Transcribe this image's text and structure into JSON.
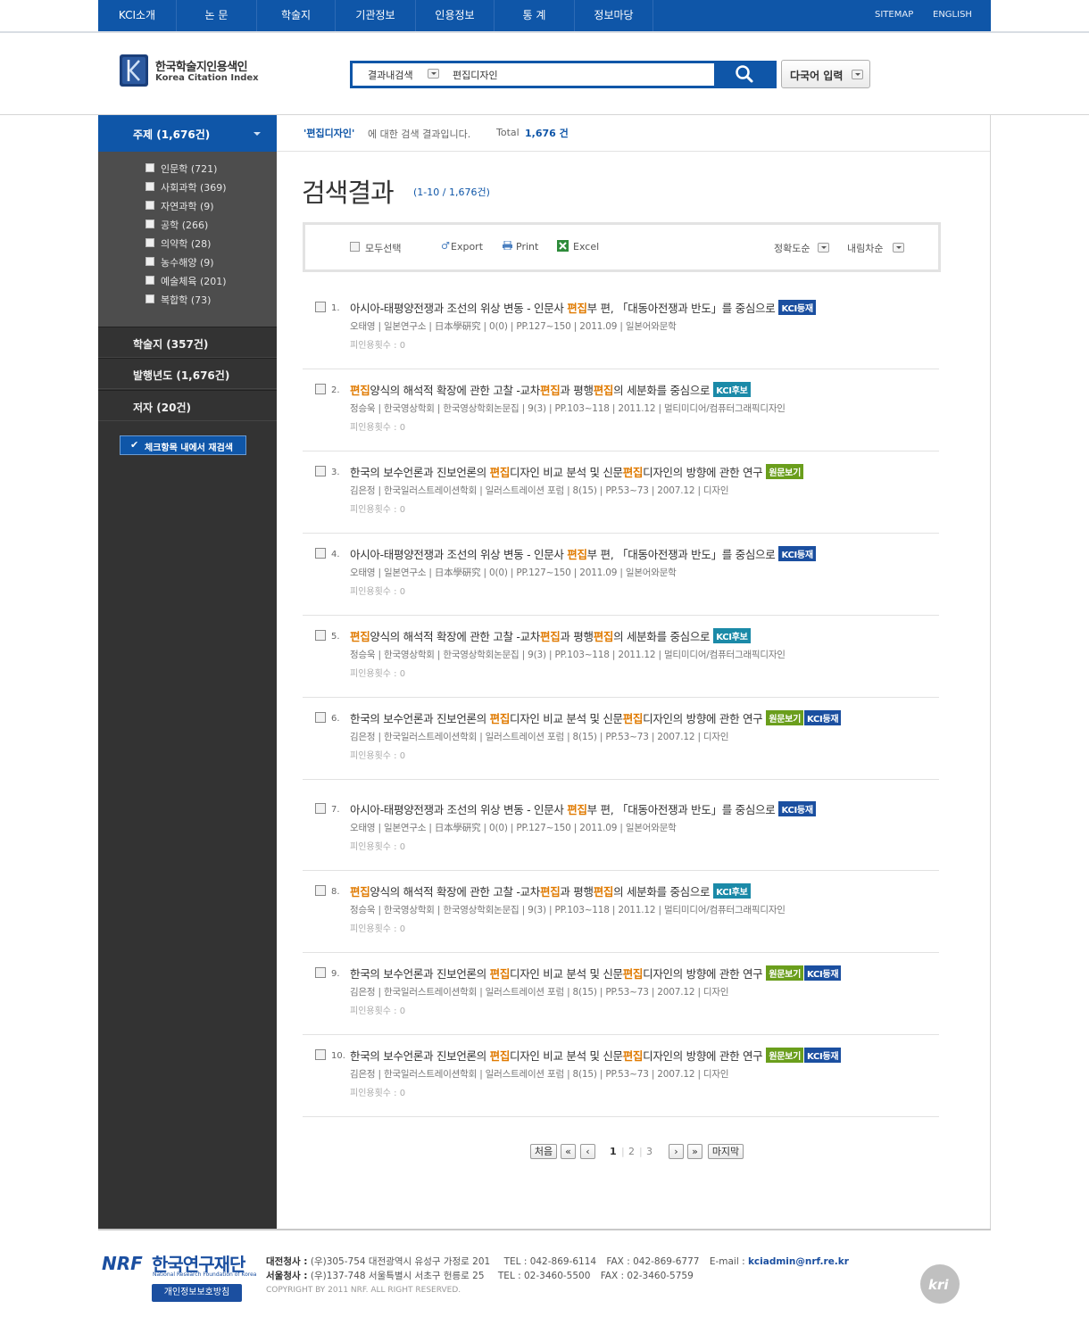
{
  "nav": {
    "items": [
      "KCI소개",
      "논 문",
      "학술지",
      "기관정보",
      "인용정보",
      "통 계",
      "정보마당"
    ],
    "sitemap": "SITEMAP",
    "english": "ENGLISH"
  },
  "logo": {
    "ko": "한국학술지인용색인",
    "en": "Korea Citation Index"
  },
  "search": {
    "scope": "결과내검색",
    "query": "편집디자인",
    "multilang": "다국어 입력"
  },
  "sidebar": {
    "subject_head": "주제 (1,676건)",
    "subjects": [
      "인문학 (721)",
      "사회과학 (369)",
      "자연과학 (9)",
      "공학 (266)",
      "의약학 (28)",
      "농수해양 (9)",
      "예술체육 (201)",
      "복합학 (73)"
    ],
    "journal": "학술지 (357건)",
    "year": "발행년도 (1,676건)",
    "author": "저자 (20건)",
    "research_btn": "체크항목 내에서 재검색",
    "research_check": "✔"
  },
  "summary": {
    "keyword": "'편집디자인'",
    "text1": "에 대한 검색 결과입니다.",
    "text2": "Total",
    "total": "1,676 건"
  },
  "results_head": {
    "title": "검색결과",
    "range": "(1-10 / 1,676건)"
  },
  "toolbar": {
    "select_all": "모두선택",
    "export": "Export",
    "print": "Print",
    "excel": "Excel",
    "sort1": "정확도순",
    "sort2": "내림차순"
  },
  "results": [
    {
      "num": "1.",
      "pre": "아시아-태평양전쟁과 조선의 위상 변동 - 인문사 ",
      "h1": "편집",
      "mid": "부 편, 「대동아전쟁과 반도」를 중심으로",
      "h2": "",
      "post": "",
      "badges": [
        {
          "label": "KCI등재",
          "type": "reg"
        }
      ],
      "meta": "오태영 | 일본연구소 | 日本學硏究 | 0(0) | PP.127~150 | 2011.09 | 일본어와문학",
      "cite": "피인용횟수 : 0"
    },
    {
      "num": "2.",
      "pre": "",
      "h1": "편집",
      "mid": "양식의 해석적 확장에 관한 고찰 -교차",
      "h2": "편집",
      "post": "과 평행",
      "h3": "편집",
      "tail": "의 세분화를 중심으로",
      "badges": [
        {
          "label": "KCI후보",
          "type": "cand"
        }
      ],
      "meta": "정승욱 | 한국영상학회 | 한국영상학회논문집 | 9(3) | PP.103~118 | 2011.12 | 멀티미디어/컴퓨터그래픽디자인",
      "cite": "피인용횟수 : 0"
    },
    {
      "num": "3.",
      "pre": "한국의 보수언론과 진보언론의 ",
      "h1": "편집",
      "mid": "디자인 비교 분석 및 신문",
      "h2": "편집",
      "post": "디자인의 방향에 관한 연구",
      "badges": [
        {
          "label": "원문보기",
          "type": "full"
        }
      ],
      "meta": "김은정 | 한국일러스트레이션학회 | 일러스트레이션 포럼 | 8(15) | PP.53~73 | 2007.12 | 디자인",
      "cite": "피인용횟수 : 0"
    },
    {
      "num": "4.",
      "pre": "아시아-태평양전쟁과 조선의 위상 변동 - 인문사 ",
      "h1": "편집",
      "mid": "부 편, 「대동아전쟁과 반도」를 중심으로",
      "h2": "",
      "post": "",
      "badges": [
        {
          "label": "KCI등재",
          "type": "reg"
        }
      ],
      "meta": "오태영 | 일본연구소 | 日本學硏究 | 0(0) | PP.127~150 | 2011.09 | 일본어와문학",
      "cite": "피인용횟수 : 0"
    },
    {
      "num": "5.",
      "pre": "",
      "h1": "편집",
      "mid": "양식의 해석적 확장에 관한 고찰 -교차",
      "h2": "편집",
      "post": "과 평행",
      "h3": "편집",
      "tail": "의 세분화를 중심으로",
      "badges": [
        {
          "label": "KCI후보",
          "type": "cand"
        }
      ],
      "meta": "정승욱 | 한국영상학회 | 한국영상학회논문집 | 9(3) | PP.103~118 | 2011.12 | 멀티미디어/컴퓨터그래픽디자인",
      "cite": "피인용횟수 : 0"
    },
    {
      "num": "6.",
      "pre": "한국의 보수언론과 진보언론의 ",
      "h1": "편집",
      "mid": "디자인 비교 분석 및 신문",
      "h2": "편집",
      "post": "디자인의 방향에 관한 연구",
      "badges": [
        {
          "label": "원문보기",
          "type": "full"
        },
        {
          "label": "KCI등재",
          "type": "reg"
        }
      ],
      "meta": "김은정 | 한국일러스트레이션학회 | 일러스트레이션 포럼 | 8(15) | PP.53~73 | 2007.12 | 디자인",
      "cite": "피인용횟수 : 0"
    },
    {
      "num": "7.",
      "pre": "아시아-태평양전쟁과 조선의 위상 변동 - 인문사 ",
      "h1": "편집",
      "mid": "부 편, 「대동아전쟁과 반도」를 중심으로",
      "h2": "",
      "post": "",
      "badges": [
        {
          "label": "KCI등재",
          "type": "reg"
        }
      ],
      "meta": "오태영 | 일본연구소 | 日本學硏究 | 0(0) | PP.127~150 | 2011.09 | 일본어와문학",
      "cite": "피인용횟수 : 0"
    },
    {
      "num": "8.",
      "pre": "",
      "h1": "편집",
      "mid": "양식의 해석적 확장에 관한 고찰 -교차",
      "h2": "편집",
      "post": "과 평행",
      "h3": "편집",
      "tail": "의 세분화를 중심으로",
      "badges": [
        {
          "label": "KCI후보",
          "type": "cand"
        }
      ],
      "meta": "정승욱 | 한국영상학회 | 한국영상학회논문집 | 9(3) | PP.103~118 | 2011.12 | 멀티미디어/컴퓨터그래픽디자인",
      "cite": "피인용횟수 : 0"
    },
    {
      "num": "9.",
      "pre": "한국의 보수언론과 진보언론의 ",
      "h1": "편집",
      "mid": "디자인 비교 분석 및 신문",
      "h2": "편집",
      "post": "디자인의 방향에 관한 연구",
      "badges": [
        {
          "label": "원문보기",
          "type": "full"
        },
        {
          "label": "KCI등재",
          "type": "reg"
        }
      ],
      "meta": "김은정 | 한국일러스트레이션학회 | 일러스트레이션 포럼 | 8(15) | PP.53~73 | 2007.12 | 디자인",
      "cite": "피인용횟수 : 0"
    },
    {
      "num": "10.",
      "pre": "한국의 보수언론과 진보언론의 ",
      "h1": "편집",
      "mid": "디자인 비교 분석 및 신문",
      "h2": "편집",
      "post": "디자인의 방향에 관한 연구",
      "badges": [
        {
          "label": "원문보기",
          "type": "full"
        },
        {
          "label": "KCI등재",
          "type": "reg"
        }
      ],
      "meta": "김은정 | 한국일러스트레이션학회 | 일러스트레이션 포럼 | 8(15) | PP.53~73 | 2007.12 | 디자인",
      "cite": "피인용횟수 : 0"
    }
  ],
  "pagination": {
    "first": "처음",
    "prev_block": "«",
    "prev": "‹",
    "pages": [
      "1",
      "2",
      "3"
    ],
    "current": "1",
    "next": "›",
    "next_block": "»",
    "last": "마지막"
  },
  "footer": {
    "nrf": "NRF",
    "org_ko": "한국연구재단",
    "org_en": "National Research Foundation of Korea",
    "privacy": "개인정보보호방침",
    "daejeon_label": "대전청사 :",
    "daejeon_addr": "(우)305-754 대전광역시 유성구 가정로 201",
    "daejeon_tel": "TEL : 042-869-6114",
    "daejeon_fax": "FAX : 042-869-6777",
    "email_label": "E-mail :",
    "email": "kciadmin@nrf.re.kr",
    "seoul_label": "서울청사 :",
    "seoul_addr": "(우)137-748 서울특별시 서초구 헌릉로 25",
    "seoul_tel": "TEL : 02-3460-5500",
    "seoul_fax": "FAX : 02-3460-5759",
    "copyright": "COPYRIGHT BY 2011 NRF. ALL RIGHT RESERVED.",
    "kri": "kri"
  },
  "colors": {
    "brand": "#0f56a8",
    "highlight": "#e07a00",
    "sidebar": "#333333"
  }
}
